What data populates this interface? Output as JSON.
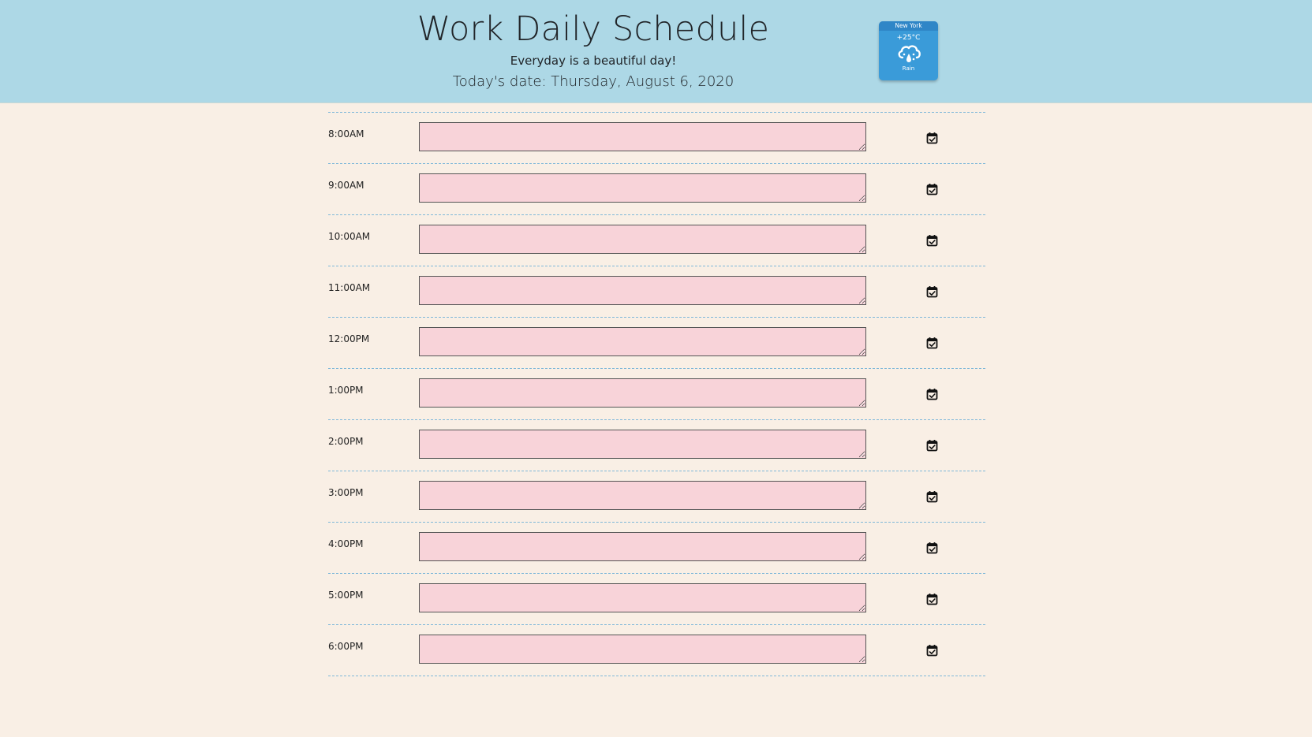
{
  "header": {
    "title": "Work Daily Schedule",
    "tagline": "Everyday is a beautiful day!",
    "today": "Today's date: Thursday, August 6, 2020"
  },
  "weather": {
    "city": "New York",
    "temperature": "+25°C",
    "condition": "Rain",
    "icon": "rain-cloud-icon",
    "color": "#3a9bd9"
  },
  "schedule": {
    "rows": [
      {
        "hour": "8:00AM",
        "task": ""
      },
      {
        "hour": "9:00AM",
        "task": ""
      },
      {
        "hour": "10:00AM",
        "task": ""
      },
      {
        "hour": "11:00AM",
        "task": ""
      },
      {
        "hour": "12:00PM",
        "task": ""
      },
      {
        "hour": "1:00PM",
        "task": ""
      },
      {
        "hour": "2:00PM",
        "task": ""
      },
      {
        "hour": "3:00PM",
        "task": ""
      },
      {
        "hour": "4:00PM",
        "task": ""
      },
      {
        "hour": "5:00PM",
        "task": ""
      },
      {
        "hour": "6:00PM",
        "task": ""
      }
    ],
    "save_icon": "calendar-check-icon"
  },
  "colors": {
    "header_bg": "#add8e6",
    "page_bg": "#f9efe5",
    "textarea_bg": "#f8d3d9"
  }
}
